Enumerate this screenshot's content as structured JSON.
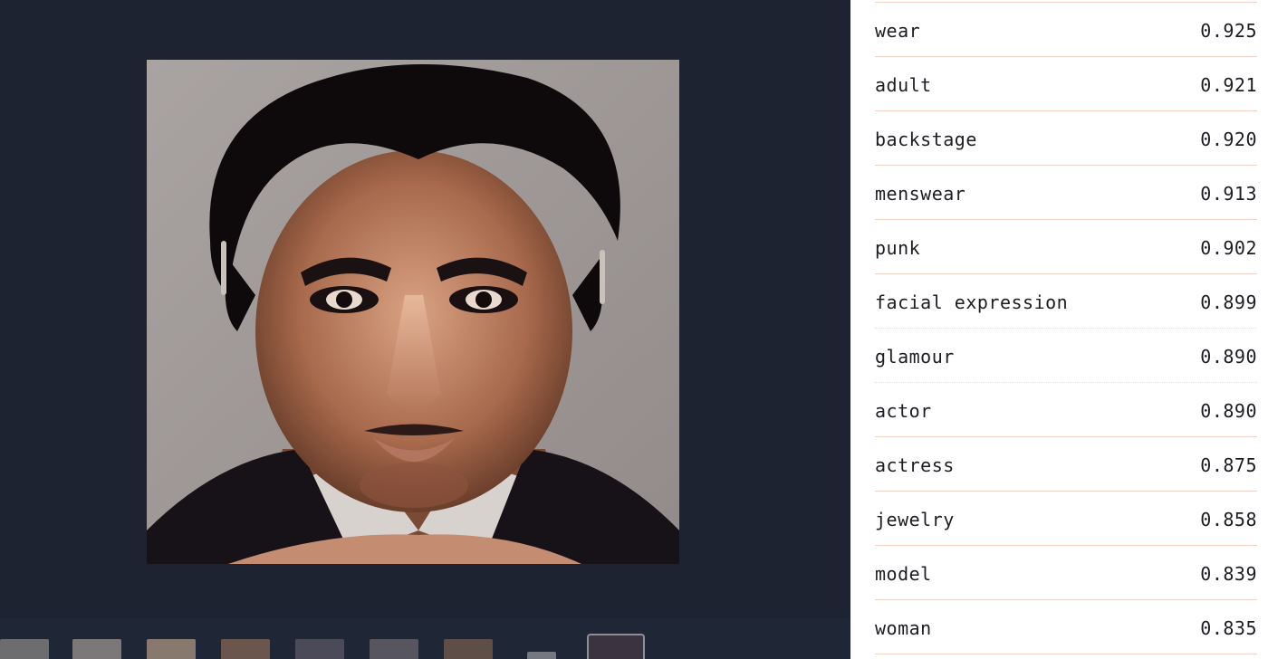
{
  "tags": [
    {
      "label": "wear",
      "score": "0.925"
    },
    {
      "label": "adult",
      "score": "0.921"
    },
    {
      "label": "backstage",
      "score": "0.920"
    },
    {
      "label": "menswear",
      "score": "0.913"
    },
    {
      "label": "punk",
      "score": "0.902"
    },
    {
      "label": "facial expression",
      "score": "0.899"
    },
    {
      "label": "glamour",
      "score": "0.890"
    },
    {
      "label": "actor",
      "score": "0.890"
    },
    {
      "label": "actress",
      "score": "0.875"
    },
    {
      "label": "jewelry",
      "score": "0.858"
    },
    {
      "label": "model",
      "score": "0.839"
    },
    {
      "label": "woman",
      "score": "0.835"
    }
  ],
  "thumbnails": [
    {
      "name": "thumbnail-1",
      "color": "#8e8a86"
    },
    {
      "name": "thumbnail-2",
      "color": "#a49b96"
    },
    {
      "name": "thumbnail-3",
      "color": "#b59c86"
    },
    {
      "name": "thumbnail-4",
      "color": "#8a6b55"
    },
    {
      "name": "thumbnail-5",
      "color": "#5e5a66"
    },
    {
      "name": "thumbnail-6",
      "color": "#6f6970"
    },
    {
      "name": "thumbnail-7",
      "color": "#7a604e"
    },
    {
      "name": "thumbnail-8",
      "color": "#9a9ba0"
    },
    {
      "name": "thumbnail-9-selected",
      "color": "#3b3340"
    }
  ],
  "colors": {
    "viewer_background": "#1e2331",
    "divider": "#f0d2c7",
    "text": "#1c1c22"
  }
}
